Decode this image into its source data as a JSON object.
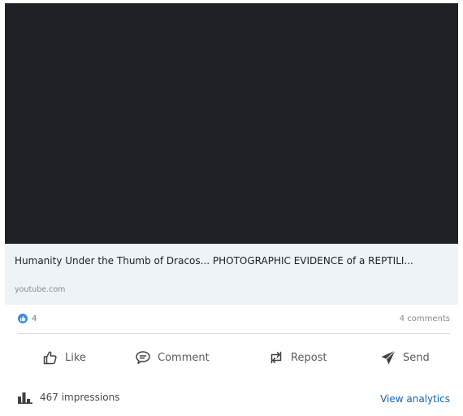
{
  "post": {
    "link_preview": {
      "title": "Humanity Under the Thumb of Dracos... PHOTOGRAPHIC EVIDENCE of a REPTILI...",
      "domain": "youtube.com"
    },
    "social_counts": {
      "reactions": "4",
      "comments": "4 comments"
    },
    "actions": {
      "like": "Like",
      "comment": "Comment",
      "repost": "Repost",
      "send": "Send"
    },
    "footer": {
      "impressions": "467 impressions",
      "view_analytics": "View analytics"
    },
    "colors": {
      "media_background": "#1e2226",
      "link_preview_background": "#eef3f8",
      "reaction_badge": "#378fe9",
      "analytics_link": "#0a66c2"
    },
    "icons": {
      "reaction": "like-reaction-icon",
      "like": "thumbs-up-icon",
      "comment": "comment-bubble-icon",
      "repost": "repost-arrows-icon",
      "send": "paper-plane-icon",
      "impressions": "bar-chart-icon"
    }
  }
}
